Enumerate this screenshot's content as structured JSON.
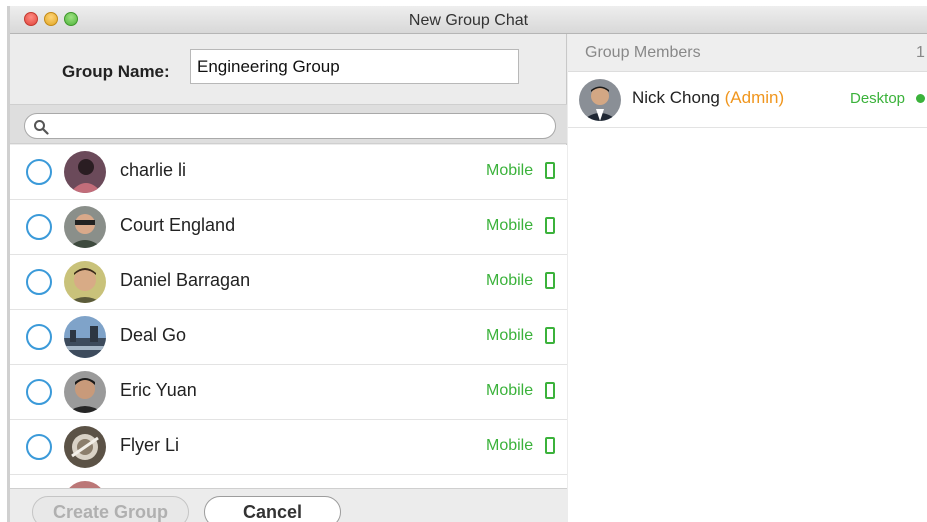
{
  "window": {
    "title": "New Group Chat"
  },
  "group_name": {
    "label": "Group Name:",
    "value": "Engineering Group"
  },
  "search": {
    "placeholder": ""
  },
  "contacts": [
    {
      "name": "charlie li",
      "status": "Mobile"
    },
    {
      "name": "Court England",
      "status": "Mobile"
    },
    {
      "name": "Daniel Barragan",
      "status": "Mobile"
    },
    {
      "name": "Deal Go",
      "status": "Mobile"
    },
    {
      "name": "Eric Yuan",
      "status": "Mobile"
    },
    {
      "name": "Flyer Li",
      "status": "Mobile"
    }
  ],
  "footer": {
    "create_label": "Create Group",
    "cancel_label": "Cancel"
  },
  "members": {
    "title": "Group Members",
    "count": "1",
    "items": [
      {
        "name": "Nick Chong",
        "role": "(Admin)",
        "status": "Desktop"
      }
    ]
  },
  "colors": {
    "status_green": "#3bb23b",
    "admin_orange": "#f0961e",
    "radio_blue": "#3b9ad9"
  },
  "icons": {
    "search": "magnifier-icon",
    "mobile": "mobile-phone-icon",
    "online": "online-dot-icon"
  }
}
